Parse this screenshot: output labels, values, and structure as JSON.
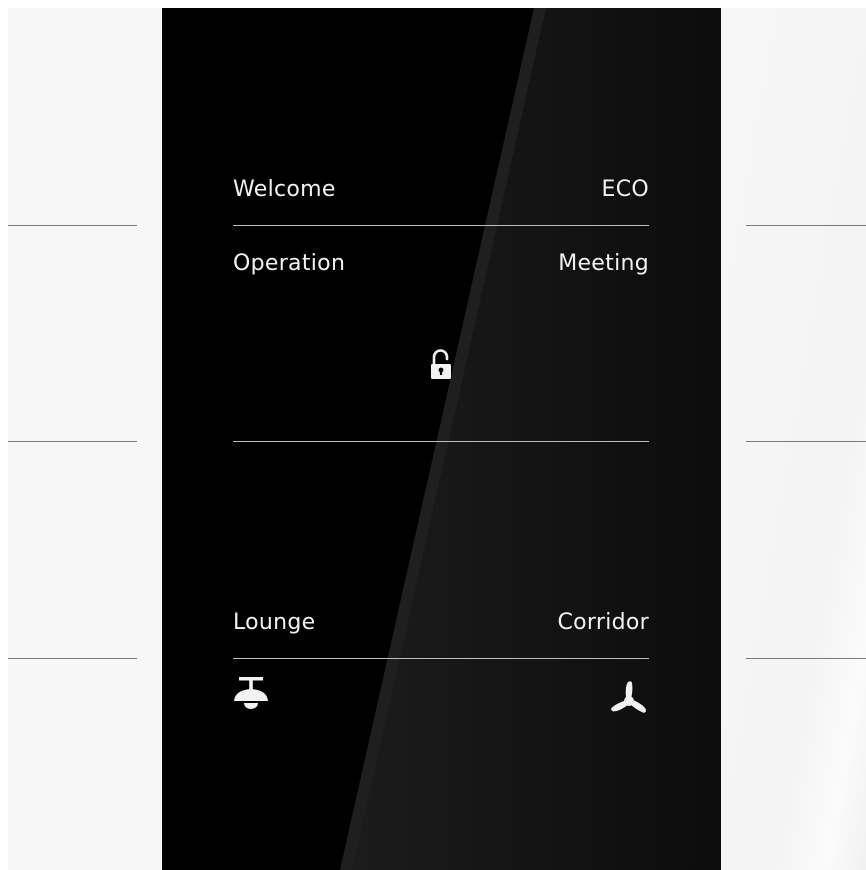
{
  "panel": {
    "row1": {
      "left_label": "Welcome",
      "right_label": "ECO"
    },
    "row2": {
      "left_label": "Operation",
      "right_label": "Meeting",
      "center_icon": "unlocked-padlock-icon"
    },
    "row3": {
      "left_label": "Lounge",
      "right_label": "Corridor",
      "left_icon": "ceiling-lamp-icon",
      "right_icon": "fan-icon"
    }
  },
  "colors": {
    "panel_background": "#000000",
    "text": "#f2f2f2",
    "divider": "#bdbdbd",
    "wall": "#f7f7f7",
    "wall_line": "#7a7a7a"
  }
}
